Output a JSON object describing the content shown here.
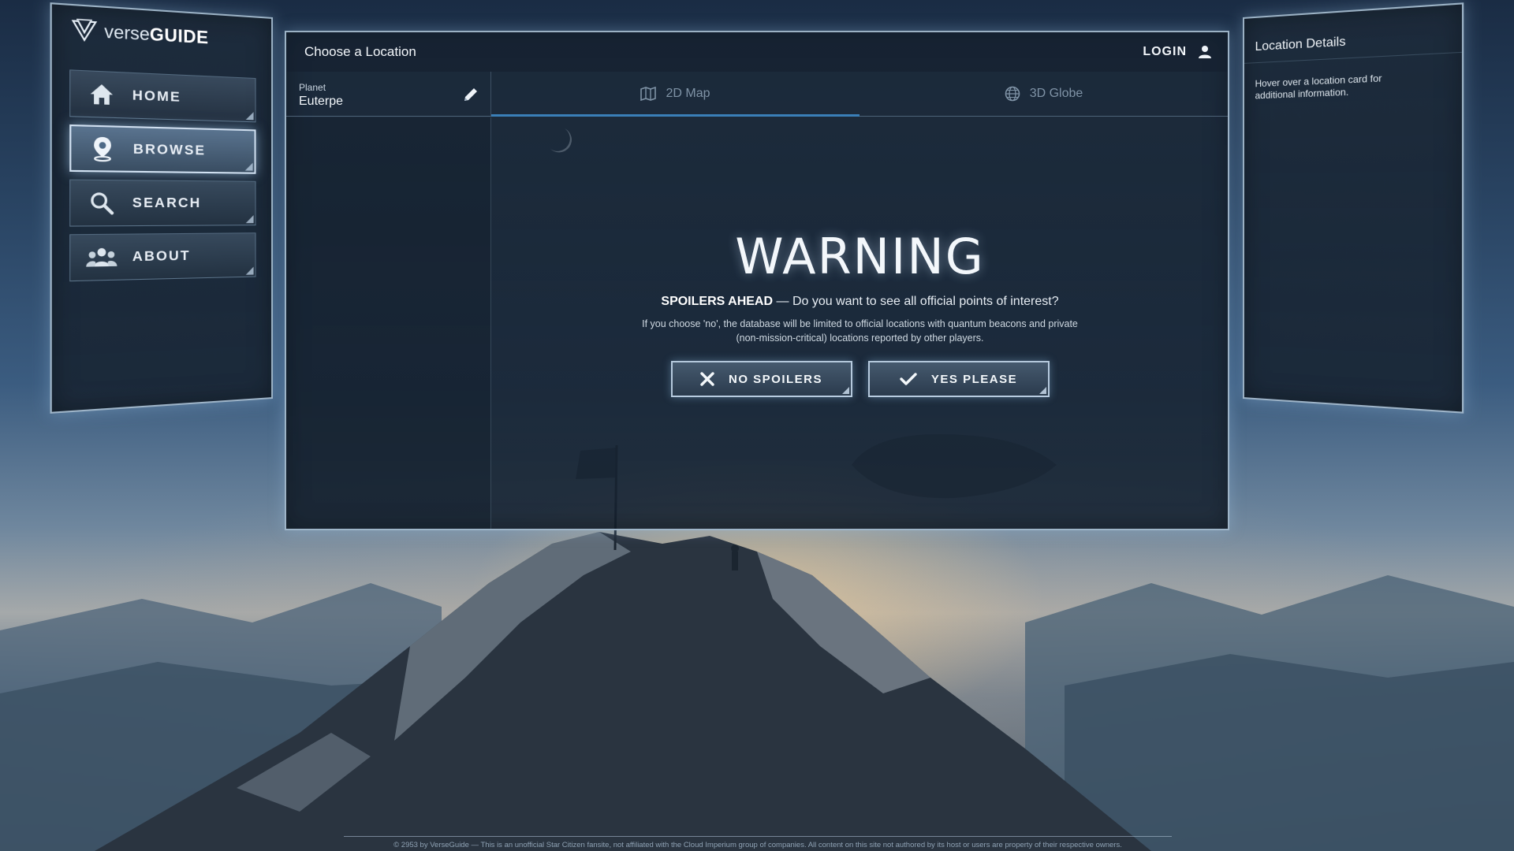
{
  "app": {
    "logo_prefix": "verse",
    "logo_suffix": "GUIDE"
  },
  "sidebar": {
    "items": [
      {
        "label": "HOME",
        "icon": "home-icon"
      },
      {
        "label": "BROWSE",
        "icon": "location-pin-icon",
        "active": true
      },
      {
        "label": "SEARCH",
        "icon": "search-icon"
      },
      {
        "label": "ABOUT",
        "icon": "group-icon"
      }
    ]
  },
  "main": {
    "title": "Choose a Location",
    "login_label": "LOGIN",
    "planet": {
      "caption": "Planet",
      "value": "Euterpe"
    },
    "tabs": [
      {
        "label": "2D Map",
        "icon": "map-icon",
        "active": true
      },
      {
        "label": "3D Globe",
        "icon": "globe-icon",
        "active": false
      }
    ],
    "warning": {
      "title": "WARNING",
      "subtitle_strong": "SPOILERS AHEAD",
      "subtitle_rest": " — Do you want to see all official points of interest?",
      "description": "If you choose 'no', the database will be limited to official locations with quantum beacons and private (non-mission-critical) locations reported by other players.",
      "no_label": "NO SPOILERS",
      "yes_label": "YES PLEASE"
    }
  },
  "details": {
    "title": "Location Details",
    "hint": "Hover over a location card for additional information."
  },
  "footer": {
    "text": "© 2953 by VerseGuide — This is an unofficial Star Citizen fansite, not affiliated with the Cloud Imperium group of companies. All content on this site not authored by its host or users are property of their respective owners."
  },
  "colors": {
    "accent": "#3a7fb8",
    "panel_border": "#c8e1f5",
    "panel_bg": "#1c2a3a"
  }
}
